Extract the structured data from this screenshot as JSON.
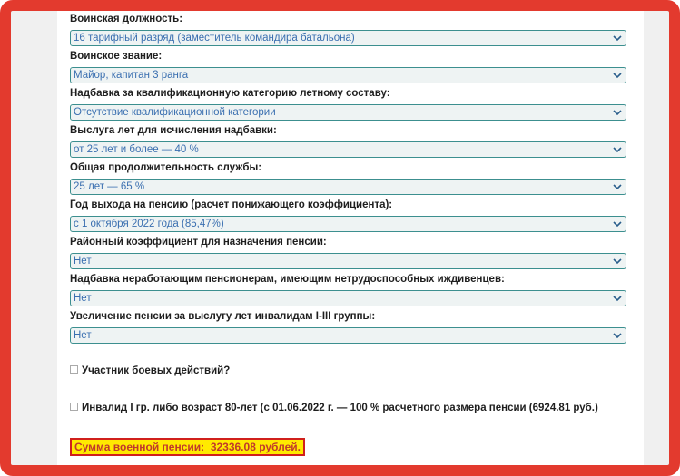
{
  "fields": [
    {
      "label": "Воинская должность:",
      "value": "16 тарифный разряд (заместитель командира батальона)"
    },
    {
      "label": "Воинское звание:",
      "value": "Майор, капитан 3 ранга"
    },
    {
      "label": "Надбавка за квалификационную категорию летному составу:",
      "value": "Отсутствие квалификационной категории"
    },
    {
      "label": "Выслуга лет для исчисления надбавки:",
      "value": "от 25 лет и более — 40 %"
    },
    {
      "label": "Общая продолжительность службы:",
      "value": "25 лет — 65 %"
    },
    {
      "label": "Год выхода на пенсию (расчет понижающего коэффициента):",
      "value": "с 1 октября 2022 года (85,47%)"
    },
    {
      "label": "Районный коэффициент для назначения пенсии:",
      "value": "Нет"
    },
    {
      "label": "Надбавка неработающим пенсионерам, имеющим нетрудоспособных иждивенцев:",
      "value": "Нет"
    },
    {
      "label": "Увеличение пенсии за выслугу лет инвалидам I-III группы:",
      "value": "Нет"
    }
  ],
  "checkboxes": {
    "combat": {
      "label": "Участник боевых действий?",
      "checked": false
    },
    "invalid": {
      "label": "Инвалид I гр. либо возраст 80-лет (с 01.06.2022 г. — 100 % расчетного размера пенсии (6924.81 руб.)",
      "checked": false
    }
  },
  "result": {
    "label": "Сумма военной пенсии:",
    "value": "32336.08 рублей."
  },
  "colors": {
    "frame": "#e33a2e",
    "select_border": "#3c8f8f",
    "select_text": "#3a6fb0",
    "result_bg": "#ffea00",
    "result_text": "#c0392b"
  },
  "icons": {
    "select_arrow": "chevron-down-icon",
    "checkbox": "checkbox-icon"
  }
}
